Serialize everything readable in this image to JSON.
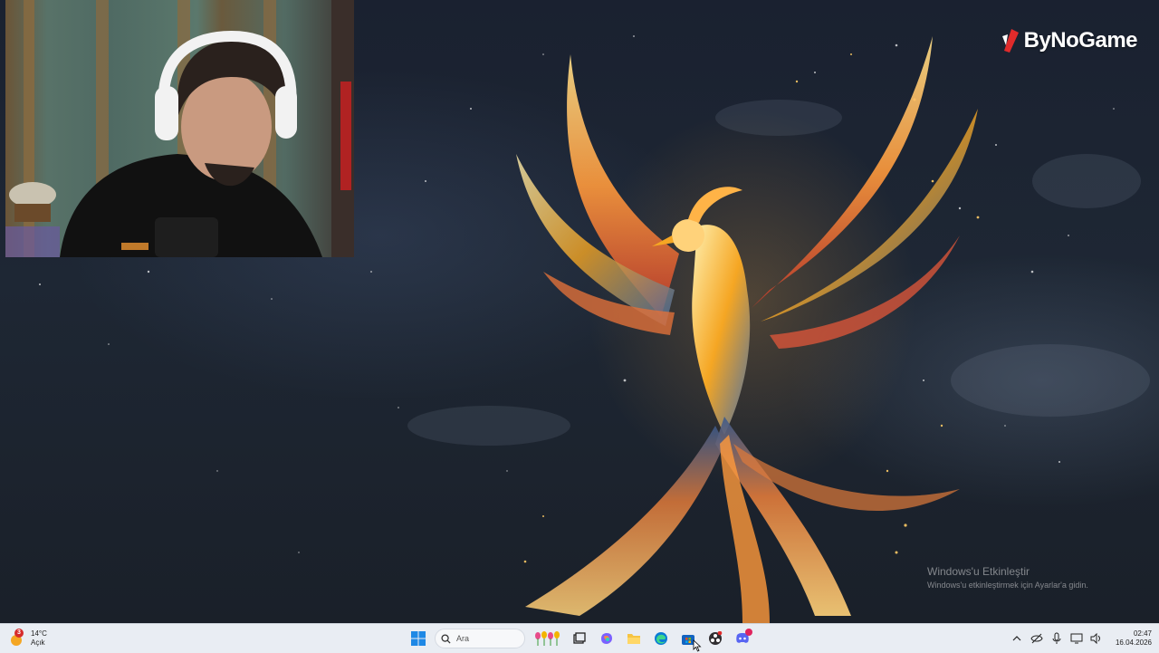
{
  "watermark": {
    "brand": "ByNoGame"
  },
  "activation": {
    "title": "Windows'u Etkinleştir",
    "subtitle": "Windows'u etkinleştirmek için Ayarlar'a gidin."
  },
  "taskbar": {
    "weather": {
      "badge": "3",
      "temperature": "14°C",
      "condition": "Açık"
    },
    "search": {
      "placeholder": "Ara"
    },
    "apps": [
      "start-icon",
      "search",
      "widgets",
      "task-view-icon",
      "copilot-icon",
      "file-explorer-icon",
      "edge-icon",
      "store-icon",
      "obs-icon",
      "discord-icon"
    ],
    "tray": {
      "icons": [
        "chevron-up-icon",
        "eye-off-icon",
        "microphone-icon",
        "display-icon",
        "speaker-icon"
      ]
    },
    "clock": {
      "time": "02:47",
      "date": "16.04.2026"
    }
  },
  "colors": {
    "taskbar_bg": "#e9edf3",
    "start_blue": "#1e88e5",
    "badge_red": "#d62b2b"
  }
}
